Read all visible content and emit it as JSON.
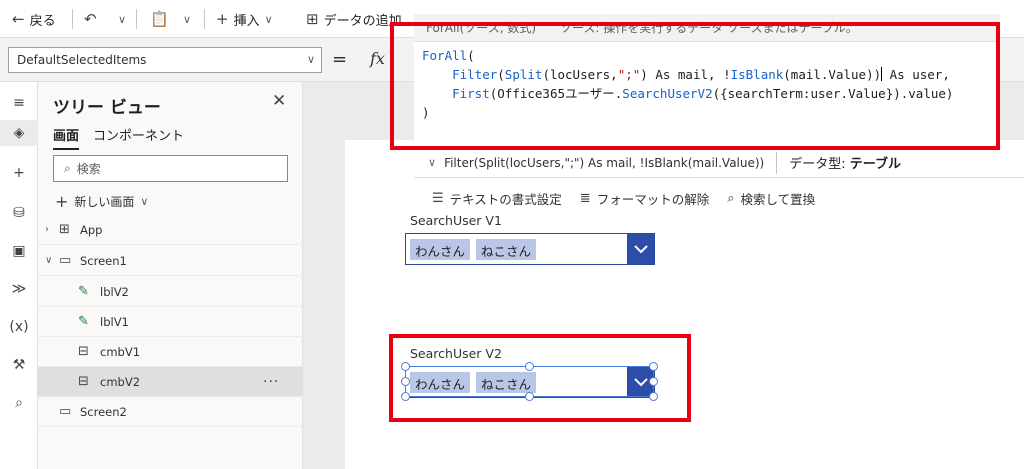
{
  "toolbar": {
    "back_label": "戻る",
    "insert_label": "挿入",
    "add_data_label": "データの追加"
  },
  "formula_bar": {
    "property_value": "DefaultSelectedItems",
    "equals": "=",
    "fx": "fx"
  },
  "tree_view": {
    "title": "ツリー ビュー",
    "tabs": [
      {
        "label": "画面"
      },
      {
        "label": "コンポーネント"
      }
    ],
    "search_placeholder": "検索",
    "new_screen_label": "新しい画面",
    "nodes": [
      {
        "label": "App"
      },
      {
        "label": "Screen1"
      },
      {
        "label": "lblV2"
      },
      {
        "label": "lblV1"
      },
      {
        "label": "cmbV1"
      },
      {
        "label": "cmbV2"
      },
      {
        "label": "Screen2"
      }
    ],
    "more_label": "···"
  },
  "editor": {
    "tab1": "ForAll(ソース, 数式)",
    "tab2": "ソース: 操作を実行するデータ ソースまたはテーブル。",
    "hint_expr": "Filter(Split(locUsers,\";\") As mail, !IsBlank(mail.Value))",
    "hint_type_prefix": "データ型:",
    "hint_type_value": "テーブル"
  },
  "code": {
    "l1_fn": "ForAll",
    "l1_rest": "(",
    "l2_indent": "    ",
    "l2_fn1": "Filter",
    "l2_a": "(",
    "l2_fn2": "Split",
    "l2_b": "(locUsers,",
    "l2_str": "\";\"",
    "l2_c": ") As mail, !",
    "l2_fn3": "IsBlank",
    "l2_d": "(mail.Value))",
    "l2_e": " As user,",
    "l3_indent": "    ",
    "l3_fn1": "First",
    "l3_a": "(Office365ユーザー.",
    "l3_fn2": "SearchUserV2",
    "l3_b": "({searchTerm:user.Value}).value)",
    "l4": ")"
  },
  "formula_tools": {
    "format_text": "テキストの書式設定",
    "remove_format": "フォーマットの解除",
    "find_replace": "検索して置換"
  },
  "combo_v1": {
    "label": "SearchUser V1",
    "chips": [
      "わんさん",
      "ねこさん"
    ]
  },
  "combo_v2": {
    "label": "SearchUser V2",
    "chips": [
      "わんさん",
      "ねこさん"
    ]
  },
  "colors": {
    "highlight": "#e60012",
    "combo_accent": "#2d4ea8",
    "chip_bg": "#b9c6e6"
  }
}
